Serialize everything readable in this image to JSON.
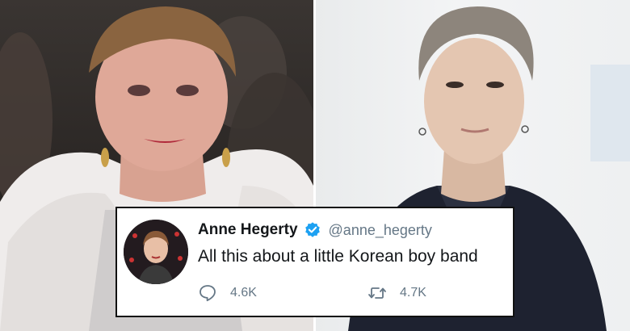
{
  "tweet": {
    "display_name": "Anne Hegerty",
    "handle": "@anne_hegerty",
    "verified": true,
    "text": "All this about a little Korean boy band",
    "reply_count": "4.6K",
    "retweet_count": "4.7K",
    "icons": {
      "verified": "verified-badge-icon",
      "reply": "reply-speech-bubble-icon",
      "retweet": "retweet-arrows-icon"
    }
  },
  "colors": {
    "twitter_blue": "#1da1f2",
    "text_dark": "#14171a",
    "text_muted": "#657786",
    "card_border": "#111111"
  }
}
